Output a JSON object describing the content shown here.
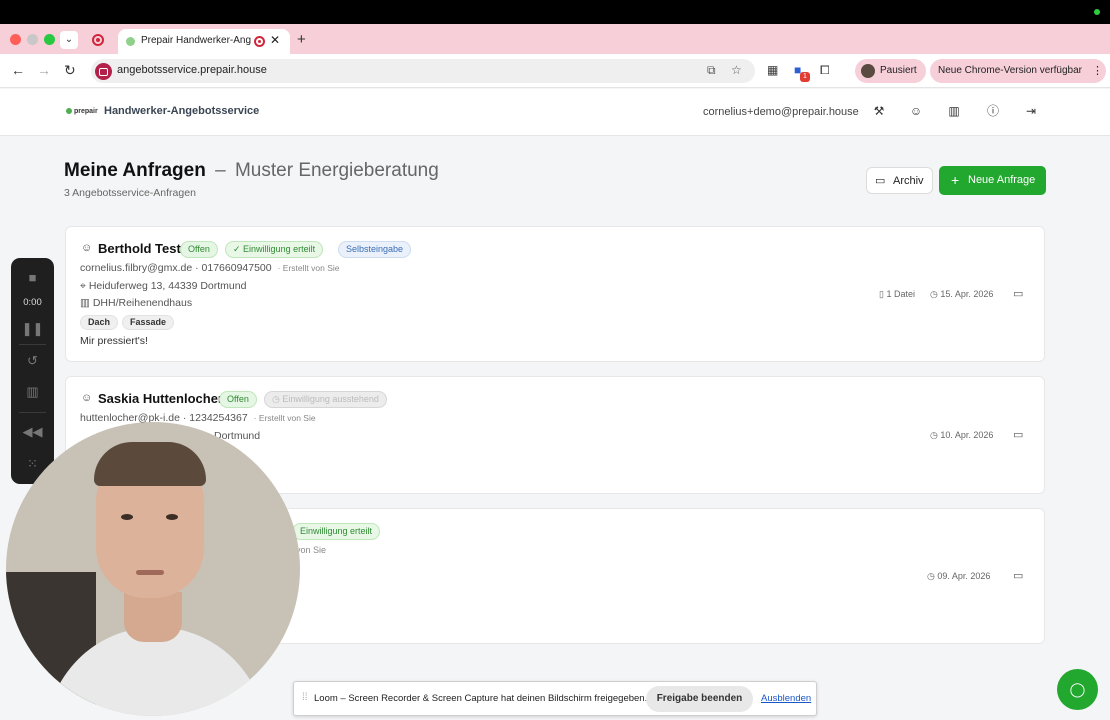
{
  "browser": {
    "tab_title": "Prepair Handwerker-Angebotsservice",
    "tab_close": "✕",
    "new_tab": "+",
    "url": "angebotsservice.prepair.house",
    "profile_status": "Pausiert",
    "update_notice": "Neue Chrome-Version verfügbar",
    "extension_badge": "1"
  },
  "app": {
    "logo_text": "prepair",
    "name": "Handwerker-Angebotsservice",
    "user_email": "cornelius+demo@prepair.house"
  },
  "page": {
    "title": "Meine Anfragen",
    "dash": "–",
    "subtitle": "Muster Energieberatung",
    "count_text": "3 Angebotsservice-Anfragen",
    "archive_button": "Archiv",
    "new_button": "Neue Anfrage"
  },
  "requests": [
    {
      "name": "Berthold Test",
      "status": "Offen",
      "consent": "Einwilligung erteilt",
      "source": "Selbsteingabe",
      "contact": "cornelius.filbry@gmx.de · 017660947500",
      "created_by": "· Erstellt von Sie",
      "address": "Heiduferweg 13, 44339 Dortmund",
      "house_type": "DHH/Reihenendhaus",
      "tags": [
        "Dach",
        "Fassade"
      ],
      "note": "Mir pressiert's!",
      "files": "1 Datei",
      "date": "15. Apr. 2026"
    },
    {
      "name": "Saskia Huttenlocher",
      "status": "Offen",
      "consent": "Einwilligung ausstehend",
      "contact": "huttenlocher@pk-i.de · 1234254367",
      "created_by": "· Erstellt von Sie",
      "address_visible": "Dortmund",
      "date": "10. Apr. 2026"
    },
    {
      "consent": "Einwilligung erteilt",
      "created_by": "von Sie",
      "date": "09. Apr. 2026"
    }
  ],
  "loom": {
    "timer": "0:00",
    "share_text": "Loom – Screen Recorder & Screen Capture hat deinen Bildschirm freigegeben.",
    "stop_button": "Freigabe beenden",
    "hide_link": "Ausblenden"
  },
  "colors": {
    "brand_green": "#22a72f",
    "tab_strip": "#f6cfd9",
    "badge_open_bg": "#e6f6e4",
    "badge_self_bg": "#eaf1fb"
  },
  "icons": [
    "search-icon",
    "translate-icon",
    "star-icon",
    "archive-icon",
    "plus-icon",
    "person-icon",
    "pin-icon",
    "building-icon",
    "file-icon",
    "clock-icon",
    "wrench-icon",
    "users-icon",
    "info-icon",
    "logout-icon",
    "chat-icon"
  ]
}
